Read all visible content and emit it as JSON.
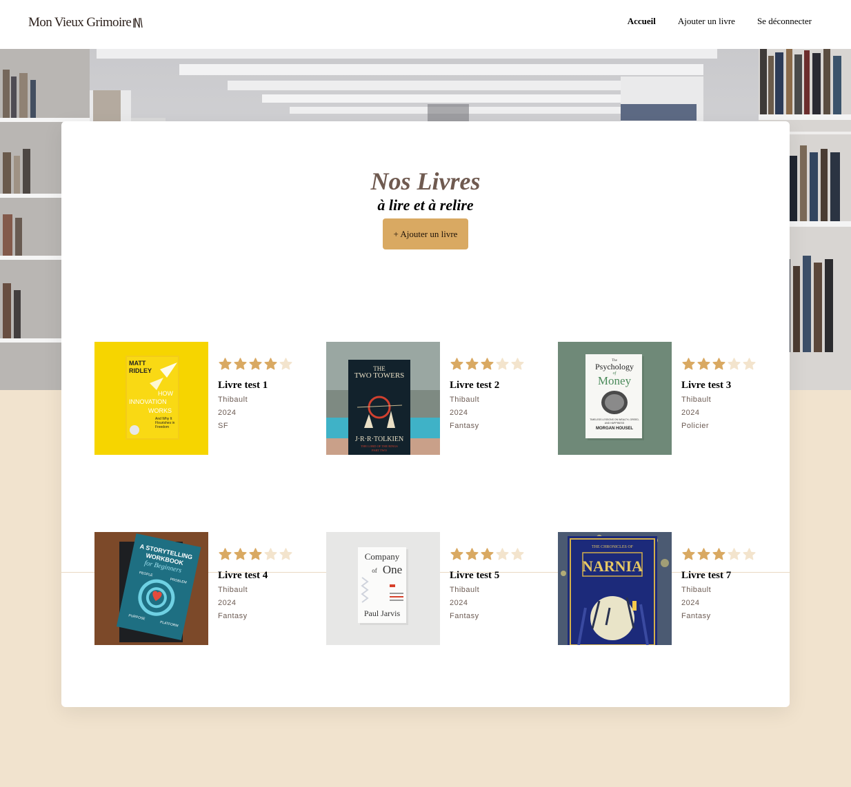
{
  "header": {
    "logo_text": "Mon Vieux Grimoire",
    "nav": [
      "Accueil",
      "Ajouter un livre",
      "Se déconnecter"
    ],
    "active_nav": "Accueil"
  },
  "main": {
    "title": "Nos Livres",
    "subtitle": "à lire et à relire",
    "add_button": "+ Ajouter un livre"
  },
  "colors": {
    "accent": "#d9a962",
    "background": "#f1e3ce",
    "star_filled": "#d9a962",
    "star_empty": "#f3e4cd",
    "title": "#6f5a50"
  },
  "books": [
    {
      "title": "Livre test 1",
      "author": "Thibault",
      "year": "2024",
      "genre": "SF",
      "rating": 4,
      "cover": "how-innovation-works",
      "cover_text": [
        "MATT",
        "RIDLEY",
        "HOW",
        "INNOVATION",
        "WORKS",
        "And Why It",
        "Flourishes in",
        "Freedom"
      ]
    },
    {
      "title": "Livre test 2",
      "author": "Thibault",
      "year": "2024",
      "genre": "Fantasy",
      "rating": 3,
      "cover": "the-two-towers",
      "cover_text": [
        "THE",
        "TWO TOWERS",
        "J·R·R·TOLKIEN",
        "THE LORD OF THE RINGS",
        "PART TWO"
      ]
    },
    {
      "title": "Livre test 3",
      "author": "Thibault",
      "year": "2024",
      "genre": "Policier",
      "rating": 3,
      "cover": "psychology-of-money",
      "cover_text": [
        "The",
        "Psychology",
        "of",
        "Money",
        "TIMELESS LESSONS ON WEALTH, GREED,",
        "AND HAPPINESS",
        "MORGAN HOUSEL"
      ]
    },
    {
      "title": "Livre test 4",
      "author": "Thibault",
      "year": "2024",
      "genre": "Fantasy",
      "rating": 3,
      "cover": "storytelling-workbook",
      "cover_text": [
        "A STORYTELLING",
        "WORKBOOK",
        "for Beginners",
        "PEOPLE",
        "PROBLEM",
        "PURPOSE",
        "PLATFORM"
      ]
    },
    {
      "title": "Livre test 5",
      "author": "Thibault",
      "year": "2024",
      "genre": "Fantasy",
      "rating": 3,
      "cover": "company-of-one",
      "cover_text": [
        "Company",
        "of",
        "One",
        "Paul Jarvis"
      ]
    },
    {
      "title": "Livre test 7",
      "author": "Thibault",
      "year": "2024",
      "genre": "Fantasy",
      "rating": 3,
      "cover": "narnia",
      "cover_text": [
        "THE CHRONICLES OF",
        "NARNIA"
      ]
    }
  ]
}
